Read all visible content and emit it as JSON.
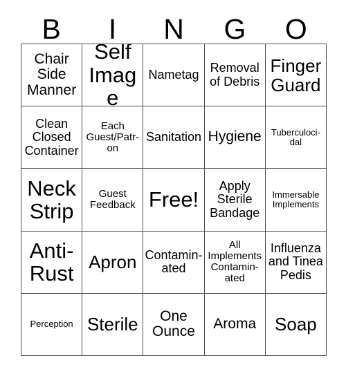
{
  "card": {
    "header_letters": [
      "B",
      "I",
      "N",
      "G",
      "O"
    ],
    "rows": [
      [
        {
          "text": "Chair Side Manner",
          "size": "fs-l"
        },
        {
          "text": "Self Image",
          "size": "fs-xxl"
        },
        {
          "text": "Nametag",
          "size": "fs-m"
        },
        {
          "text": "Removal of Debris",
          "size": "fs-m"
        },
        {
          "text": "Finger Guard",
          "size": "fs-xl"
        }
      ],
      [
        {
          "text": "Clean Closed Container",
          "size": "fs-m"
        },
        {
          "text": "Each Guest/Patr-on",
          "size": "fs-s"
        },
        {
          "text": "Sanitation",
          "size": "fs-m"
        },
        {
          "text": "Hygiene",
          "size": "fs-l"
        },
        {
          "text": "Tuberculoci-dal",
          "size": "fs-xs"
        }
      ],
      [
        {
          "text": "Neck Strip",
          "size": "fs-xxl"
        },
        {
          "text": "Guest Feedback",
          "size": "fs-s"
        },
        {
          "text": "Free!",
          "size": "fs-free"
        },
        {
          "text": "Apply Sterile Bandage",
          "size": "fs-m"
        },
        {
          "text": "Immersable Implements",
          "size": "fs-xs"
        }
      ],
      [
        {
          "text": "Anti-Rust",
          "size": "fs-xxl"
        },
        {
          "text": "Apron",
          "size": "fs-xl"
        },
        {
          "text": "Contamin-ated",
          "size": "fs-m"
        },
        {
          "text": "All Implements Contamin-ated",
          "size": "fs-s"
        },
        {
          "text": "Influenza and Tinea Pedis",
          "size": "fs-m"
        }
      ],
      [
        {
          "text": "Perception",
          "size": "fs-xs"
        },
        {
          "text": "Sterile",
          "size": "fs-xl"
        },
        {
          "text": "One Ounce",
          "size": "fs-l"
        },
        {
          "text": "Aroma",
          "size": "fs-l"
        },
        {
          "text": "Soap",
          "size": "fs-xl"
        }
      ]
    ]
  }
}
